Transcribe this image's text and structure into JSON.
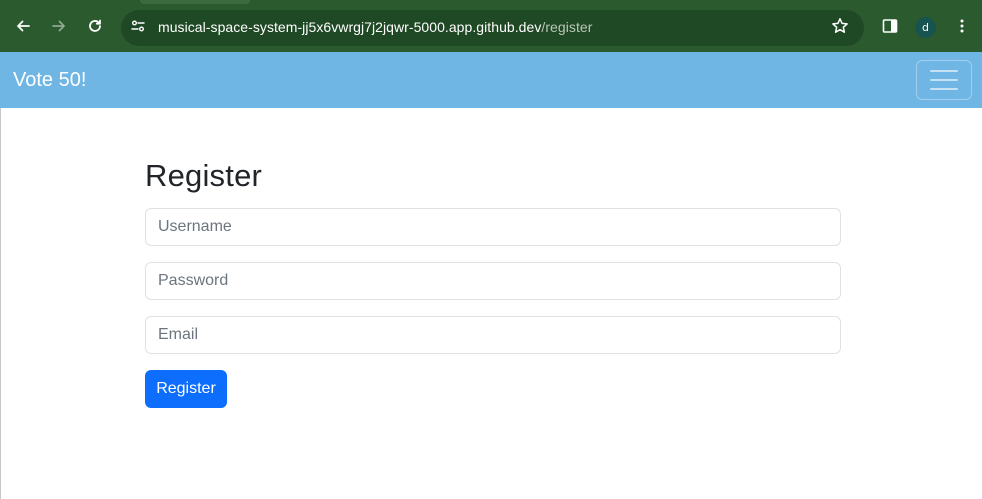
{
  "browser": {
    "url_host": "musical-space-system-jj5x6vwrgj7j2jqwr-5000.app.github.dev",
    "url_path": "/register",
    "profile_initial": "d",
    "icons": [
      "back-icon",
      "forward-icon",
      "reload-icon",
      "site-info-icon",
      "bookmark-star-icon",
      "side-panel-icon",
      "profile-avatar",
      "menu-kebab-icon"
    ]
  },
  "navbar": {
    "brand": "Vote 50!",
    "background": "#6fb6e4",
    "toggler_icon": "hamburger-icon"
  },
  "form": {
    "heading": "Register",
    "username_placeholder": "Username",
    "password_placeholder": "Password",
    "email_placeholder": "Email",
    "submit_label": "Register",
    "submit_color": "#0d6efd"
  }
}
